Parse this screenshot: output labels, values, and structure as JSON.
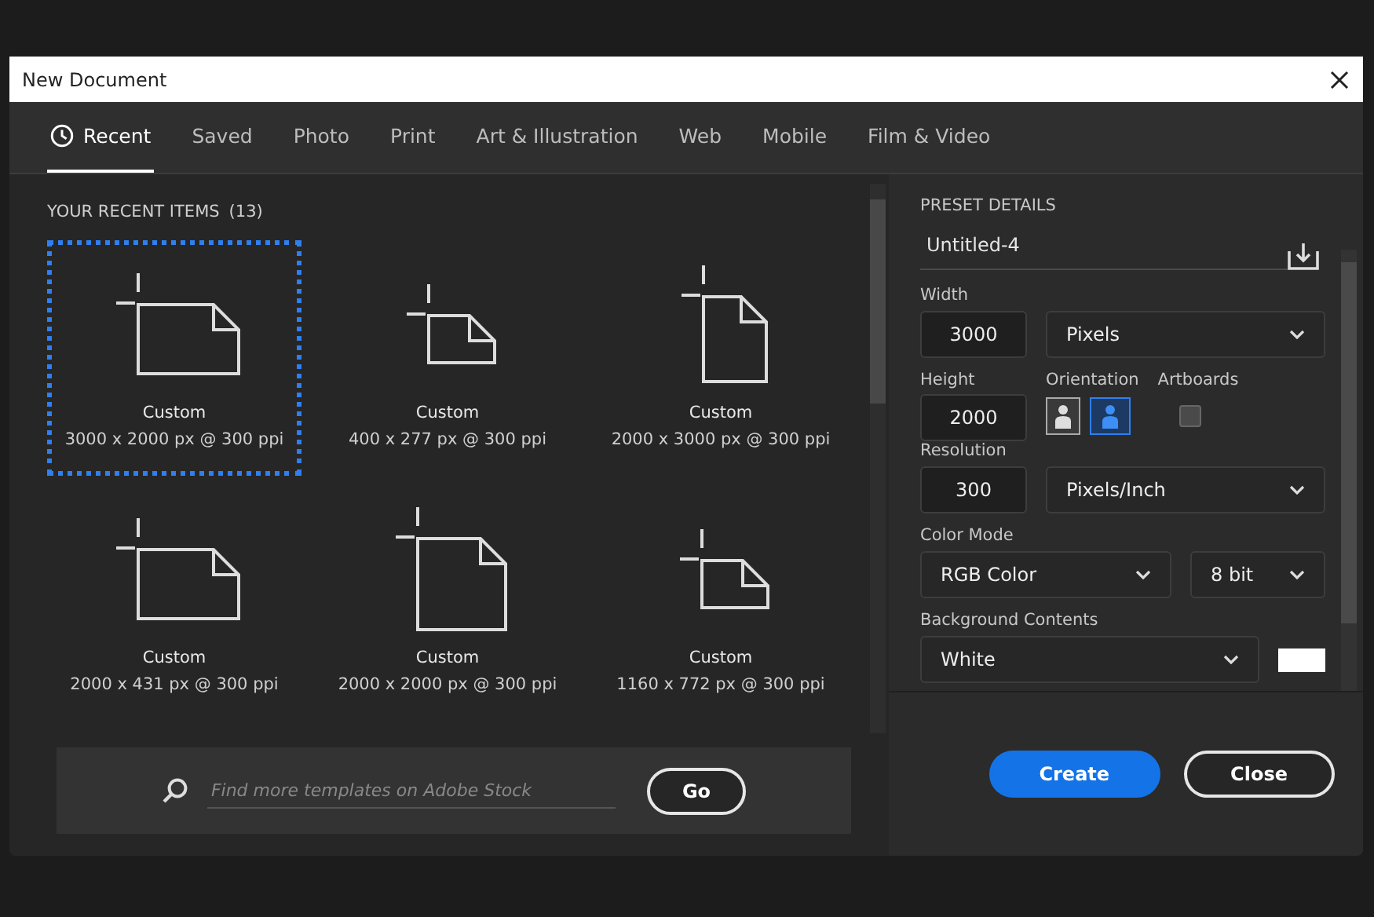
{
  "window": {
    "title": "New Document"
  },
  "tabs": [
    {
      "label": "Recent",
      "selected": true,
      "kind": "clock"
    },
    {
      "label": "Saved",
      "selected": false
    },
    {
      "label": "Photo",
      "selected": false
    },
    {
      "label": "Print",
      "selected": false
    },
    {
      "label": "Art & Illustration",
      "selected": false
    },
    {
      "label": "Web",
      "selected": false
    },
    {
      "label": "Mobile",
      "selected": false
    },
    {
      "label": "Film & Video",
      "selected": false
    }
  ],
  "recent": {
    "heading": "YOUR RECENT ITEMS",
    "count": "(13)",
    "items": [
      {
        "name": "Custom",
        "size": "3000 x 2000 px @ 300 ppi",
        "kind": "landscape",
        "selected": true
      },
      {
        "name": "Custom",
        "size": "400 x 277 px @ 300 ppi",
        "kind": "small",
        "selected": false
      },
      {
        "name": "Custom",
        "size": "2000 x 3000 px @ 300 ppi",
        "kind": "portrait",
        "selected": false
      },
      {
        "name": "Custom",
        "size": "2000 x 431 px @ 300 ppi",
        "kind": "landscape",
        "selected": false
      },
      {
        "name": "Custom",
        "size": "2000 x 2000 px @ 300 ppi",
        "kind": "square",
        "selected": false
      },
      {
        "name": "Custom",
        "size": "1160 x 772 px @ 300 ppi",
        "kind": "small",
        "selected": false
      }
    ]
  },
  "search": {
    "placeholder": "Find more templates on Adobe Stock",
    "button": "Go"
  },
  "preset": {
    "heading": "PRESET DETAILS",
    "name": "Untitled-4",
    "width": {
      "label": "Width",
      "value": "3000",
      "unit": "Pixels"
    },
    "height": {
      "label": "Height",
      "value": "2000"
    },
    "orientation": {
      "label": "Orientation",
      "options": [
        {
          "kind": "portrait",
          "selected": false
        },
        {
          "kind": "landscape",
          "selected": true
        }
      ]
    },
    "artboards": {
      "label": "Artboards",
      "checked": false
    },
    "resolution": {
      "label": "Resolution",
      "value": "300",
      "unit": "Pixels/Inch"
    },
    "color_mode": {
      "label": "Color Mode",
      "mode": "RGB Color",
      "depth": "8 bit"
    },
    "background": {
      "label": "Background Contents",
      "value": "White"
    }
  },
  "buttons": [
    {
      "label": "Create",
      "kind": "primary"
    },
    {
      "label": "Close",
      "kind": "secondary"
    }
  ]
}
